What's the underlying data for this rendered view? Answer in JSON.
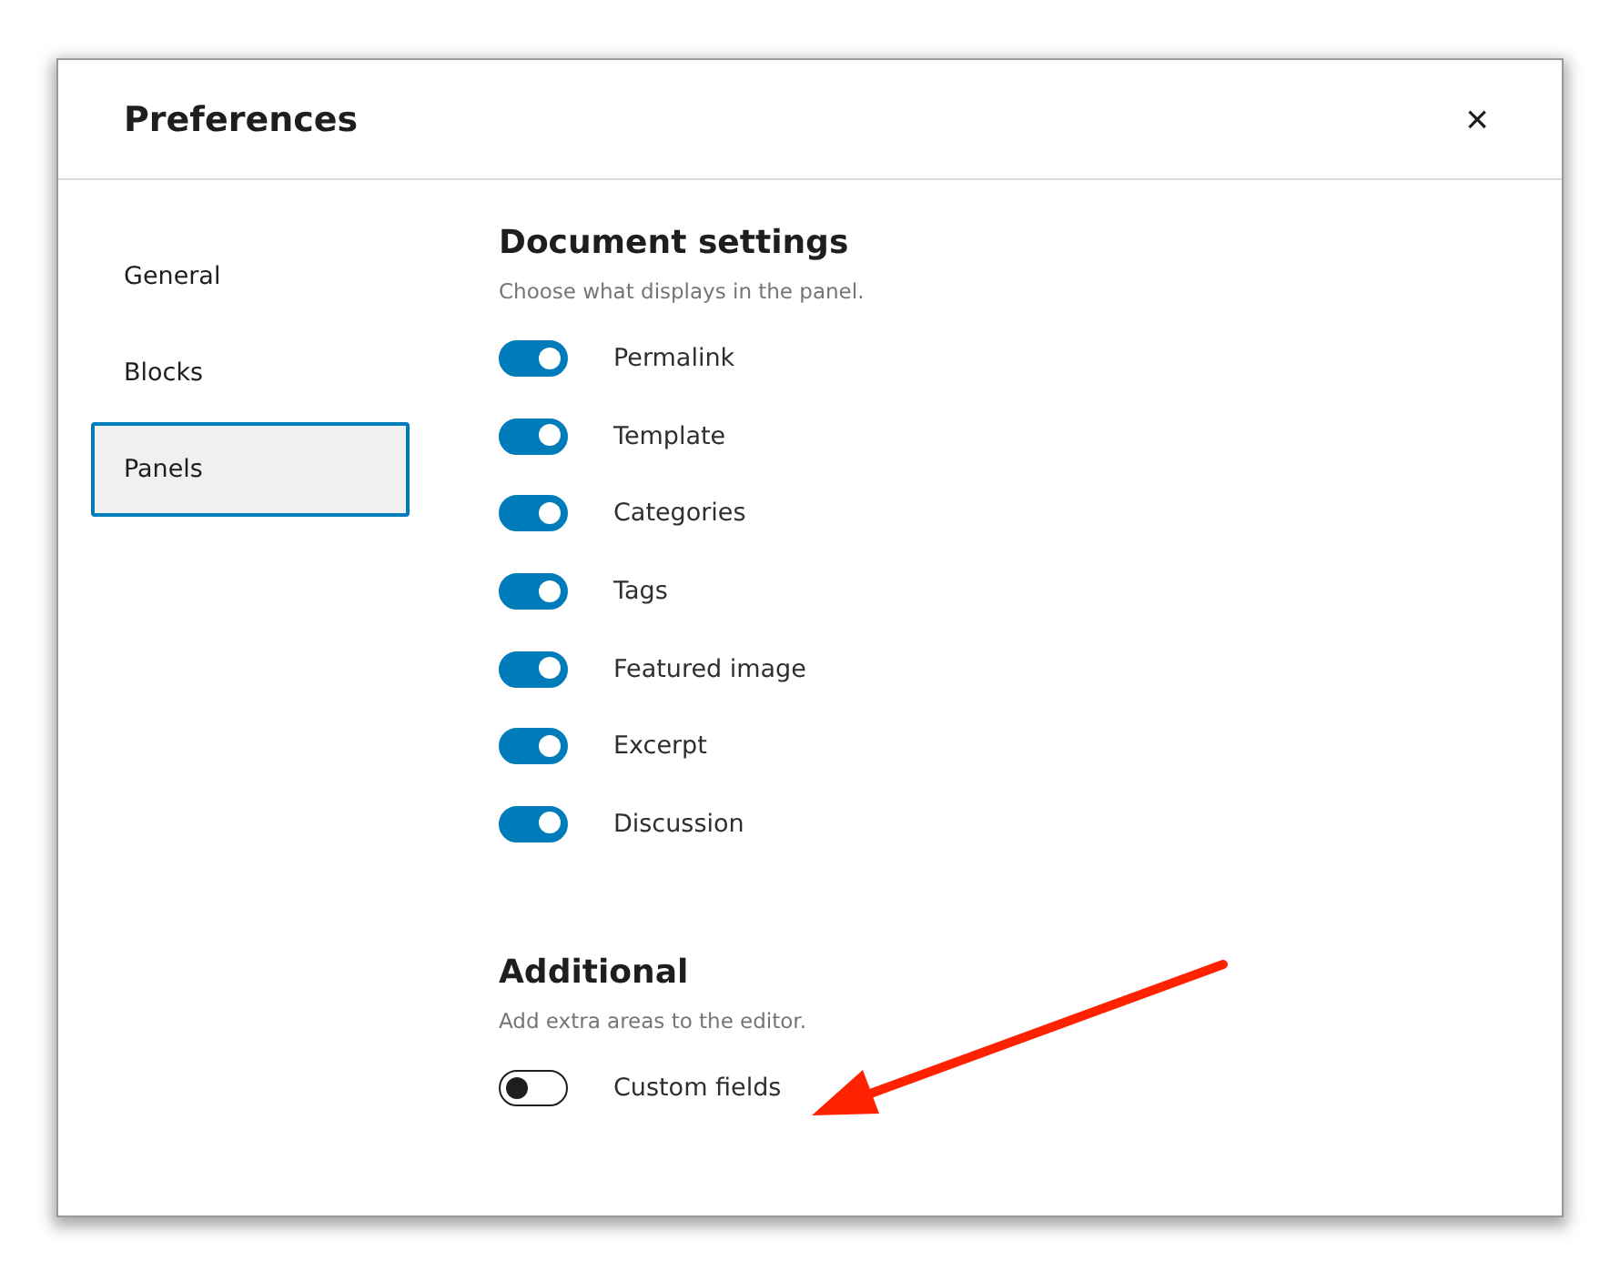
{
  "dialog": {
    "title": "Preferences",
    "close_label": "×"
  },
  "sidebar": {
    "items": [
      {
        "label": "General",
        "selected": false
      },
      {
        "label": "Blocks",
        "selected": false
      },
      {
        "label": "Panels",
        "selected": true
      }
    ]
  },
  "sections": [
    {
      "title": "Document settings",
      "description": "Choose what displays in the panel.",
      "options": [
        {
          "label": "Permalink",
          "on": true
        },
        {
          "label": "Template",
          "on": true
        },
        {
          "label": "Categories",
          "on": true
        },
        {
          "label": "Tags",
          "on": true
        },
        {
          "label": "Featured image",
          "on": true
        },
        {
          "label": "Excerpt",
          "on": true
        },
        {
          "label": "Discussion",
          "on": true
        }
      ]
    },
    {
      "title": "Additional",
      "description": "Add extra areas to the editor.",
      "options": [
        {
          "label": "Custom fields",
          "on": false
        }
      ]
    }
  ]
}
